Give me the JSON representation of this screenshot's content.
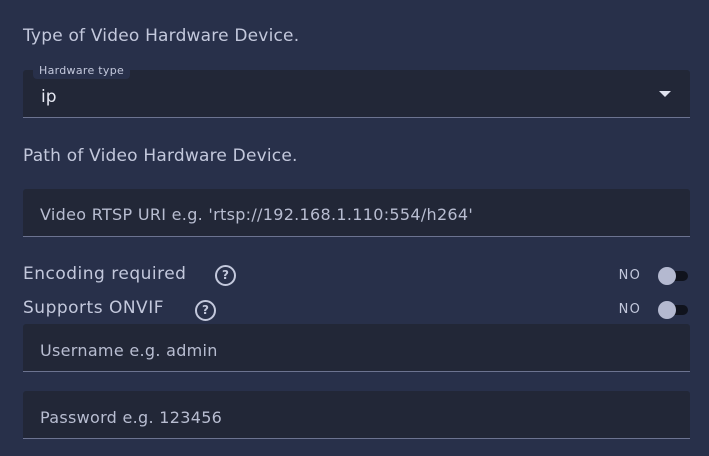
{
  "hardware_type_section": {
    "title": "Type of Video Hardware Device.",
    "select_label": "Hardware type",
    "select_value": "ip"
  },
  "hardware_path_section": {
    "title": "Path of Video Hardware Device.",
    "rtsp_placeholder": "Video RTSP URI e.g. 'rtsp://192.168.1.110:554/h264'"
  },
  "toggles": [
    {
      "label": "Encoding required",
      "help": "?",
      "state_text": "NO",
      "enabled": false
    },
    {
      "label": "Supports ONVIF",
      "help": "?",
      "state_text": "NO",
      "enabled": false
    }
  ],
  "credentials": {
    "username_placeholder": "Username e.g. admin",
    "password_placeholder": "Password e.g. 123456"
  },
  "colors": {
    "background": "#28304a",
    "field_background": "#222737",
    "switch_thumb": "#b4b9d0",
    "switch_track": "#10131d"
  }
}
